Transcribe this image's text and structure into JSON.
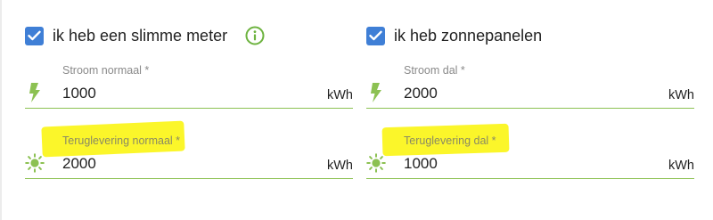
{
  "left": {
    "checkbox_label": "ik heb een slimme meter",
    "checked": true,
    "info_icon": "info-icon",
    "fields": [
      {
        "label": "Stroom normaal *",
        "value": "1000",
        "unit": "kWh",
        "icon": "lightning-icon",
        "highlighted": false
      },
      {
        "label": "Teruglevering normaal *",
        "value": "2000",
        "unit": "kWh",
        "icon": "sun-icon",
        "highlighted": true
      }
    ]
  },
  "right": {
    "checkbox_label": "ik heb zonnepanelen",
    "checked": true,
    "fields": [
      {
        "label": "Stroom dal *",
        "value": "2000",
        "unit": "kWh",
        "icon": "lightning-icon",
        "highlighted": false
      },
      {
        "label": "Teruglevering dal *",
        "value": "1000",
        "unit": "kWh",
        "icon": "sun-icon",
        "highlighted": true
      }
    ]
  },
  "colors": {
    "checkbox": "#3f7fd6",
    "accent_green": "#8cc152",
    "highlight": "#fbf62a"
  }
}
